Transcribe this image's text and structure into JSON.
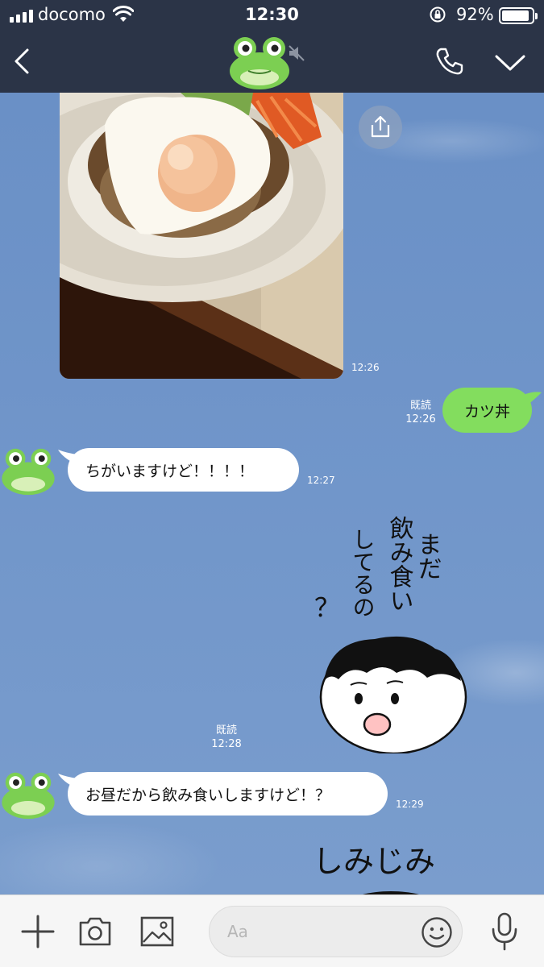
{
  "status_bar": {
    "carrier": "docomo",
    "time": "12:30",
    "battery_percent": "92%",
    "battery_level": 0.92
  },
  "nav": {
    "back_icon": "back-chevron-icon",
    "avatar_icon": "frog-avatar-icon",
    "mute_icon": "mute-icon",
    "call_icon": "phone-icon",
    "menu_icon": "chevron-down-icon"
  },
  "messages": {
    "photo": {
      "time": "12:26"
    },
    "outgoing": {
      "text": "カツ丼",
      "read_label": "既読",
      "time": "12:26"
    },
    "incoming_1": {
      "text": "ちがいますけど！！！！",
      "time": "12:27"
    },
    "sticker_1": {
      "line1": "まだ",
      "line2": "飲み食い",
      "line3": "してるの",
      "line4": "？",
      "read_label": "既読",
      "time": "12:28"
    },
    "incoming_2": {
      "text": "お昼だから飲み食いしますけど！？",
      "time": "12:29"
    },
    "sticker_2": {
      "text": "しみじみ"
    }
  },
  "input_bar": {
    "placeholder": "Aa",
    "icons": [
      "plus-icon",
      "camera-icon",
      "image-icon",
      "emoji-icon",
      "microphone-icon"
    ]
  },
  "colors": {
    "header_bg": "#2b3447",
    "chat_bg": "#6f95c8",
    "outgoing_bubble": "#83dd5e",
    "incoming_bubble": "#ffffff",
    "frog_green": "#7ccf52"
  }
}
